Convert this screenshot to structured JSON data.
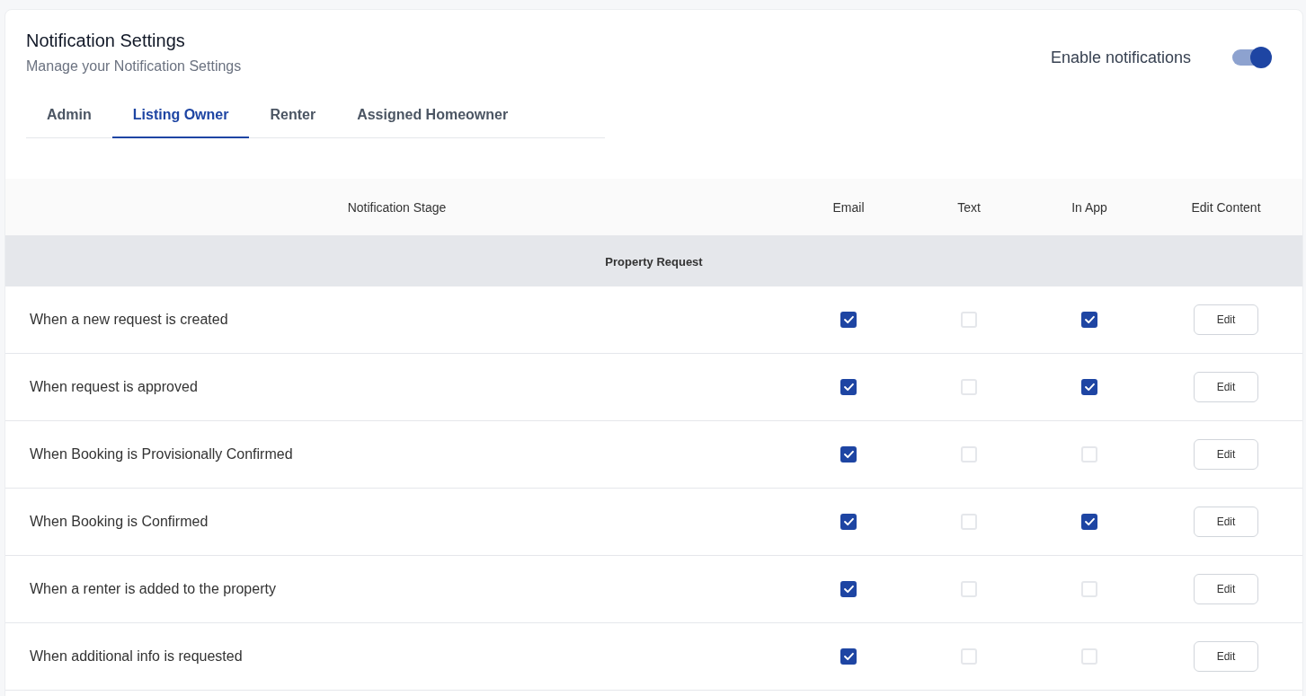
{
  "header": {
    "title": "Notification Settings",
    "subtitle": "Manage your Notification Settings"
  },
  "enable_notifications": {
    "label": "Enable notifications",
    "on": true
  },
  "tabs": [
    {
      "label": "Admin",
      "selected": false
    },
    {
      "label": "Listing Owner",
      "selected": true
    },
    {
      "label": "Renter",
      "selected": false
    },
    {
      "label": "Assigned Homeowner",
      "selected": false
    }
  ],
  "table": {
    "columns": [
      "Notification Stage",
      "Email",
      "Text",
      "In App",
      "Edit Content"
    ],
    "group": "Property Request",
    "rows": [
      {
        "stage": "When a new request is created",
        "email": true,
        "text": false,
        "in_app": true,
        "action": "Edit"
      },
      {
        "stage": "When request is approved",
        "email": true,
        "text": false,
        "in_app": true,
        "action": "Edit"
      },
      {
        "stage": "When Booking is Provisionally Confirmed",
        "email": true,
        "text": false,
        "in_app": false,
        "action": "Edit"
      },
      {
        "stage": "When Booking is Confirmed",
        "email": true,
        "text": false,
        "in_app": true,
        "action": "Edit"
      },
      {
        "stage": "When a renter is added to the property",
        "email": true,
        "text": false,
        "in_app": false,
        "action": "Edit"
      },
      {
        "stage": "When additional info is requested",
        "email": true,
        "text": false,
        "in_app": false,
        "action": "Edit"
      }
    ]
  }
}
